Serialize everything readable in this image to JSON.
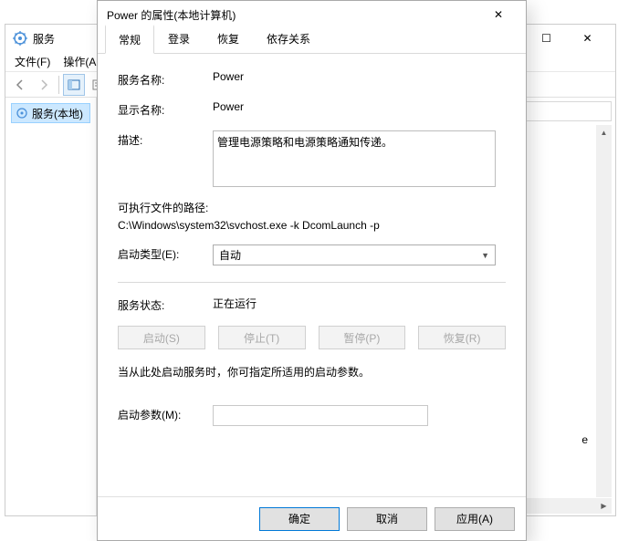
{
  "bg": {
    "title": "服务",
    "menus": {
      "file": "文件(F)",
      "action": "操作(A"
    },
    "tree_item": "服务(本地)",
    "win": {
      "min": "—",
      "max": "☐",
      "close": "✕"
    },
    "letter": "e"
  },
  "dlg": {
    "title": "Power 的属性(本地计算机)",
    "close": "✕",
    "tabs": {
      "general": "常规",
      "logon": "登录",
      "recovery": "恢复",
      "deps": "依存关系"
    },
    "labels": {
      "service_name": "服务名称:",
      "display_name": "显示名称:",
      "description": "描述:",
      "exe_path": "可执行文件的路径:",
      "startup_type": "启动类型(E):",
      "service_status": "服务状态:",
      "start_params": "启动参数(M):"
    },
    "values": {
      "service_name": "Power",
      "display_name": "Power",
      "description": "管理电源策略和电源策略通知传递。",
      "exe_path": "C:\\Windows\\system32\\svchost.exe -k DcomLaunch -p",
      "startup_type": "自动",
      "service_status": "正在运行"
    },
    "svc_btns": {
      "start": "启动(S)",
      "stop": "停止(T)",
      "pause": "暂停(P)",
      "resume": "恢复(R)"
    },
    "note": "当从此处启动服务时，你可指定所适用的启动参数。",
    "footer": {
      "ok": "确定",
      "cancel": "取消",
      "apply": "应用(A)"
    }
  }
}
